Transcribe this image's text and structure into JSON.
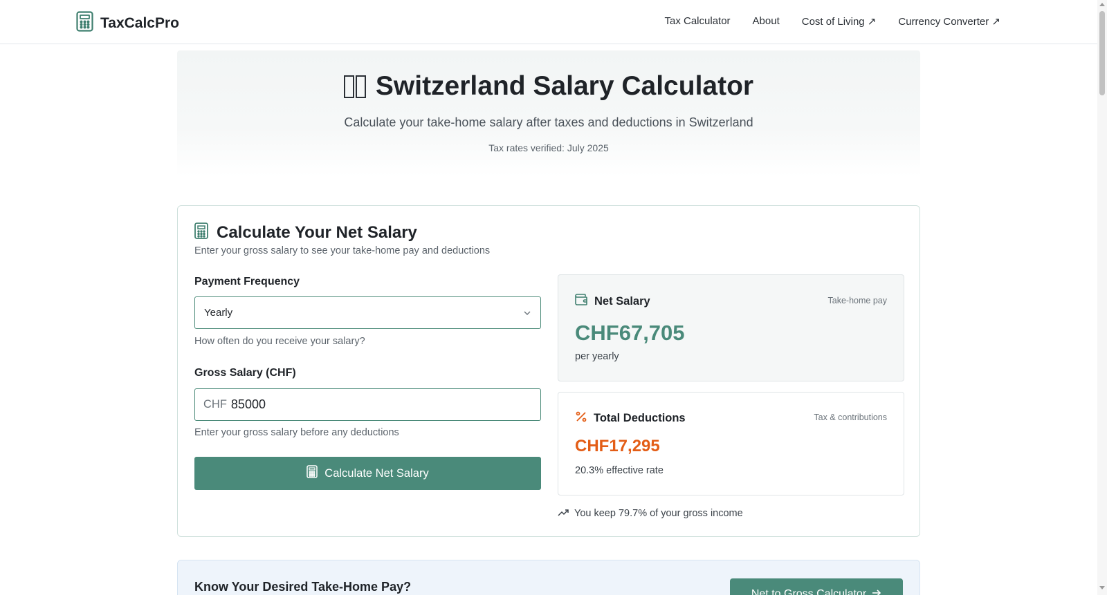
{
  "header": {
    "brand": "TaxCalcPro",
    "nav": [
      {
        "label": "Tax Calculator"
      },
      {
        "label": "About"
      },
      {
        "label": "Cost of Living ↗"
      },
      {
        "label": "Currency Converter ↗"
      }
    ]
  },
  "hero": {
    "title": "Switzerland Salary Calculator",
    "subtitle": "Calculate your take-home salary after taxes and deductions in Switzerland",
    "verified": "Tax rates verified: July 2025"
  },
  "calculator": {
    "title": "Calculate Your Net Salary",
    "description": "Enter your gross salary to see your take-home pay and deductions",
    "frequency": {
      "label": "Payment Frequency",
      "value": "Yearly",
      "help": "How often do you receive your salary?"
    },
    "gross": {
      "label": "Gross Salary (CHF)",
      "prefix": "CHF",
      "value": "85000",
      "help": "Enter your gross salary before any deductions"
    },
    "button_label": "Calculate Net Salary"
  },
  "results": {
    "net": {
      "title": "Net Salary",
      "tag": "Take-home pay",
      "value": "CHF67,705",
      "period": "per yearly"
    },
    "deductions": {
      "title": "Total Deductions",
      "tag": "Tax & contributions",
      "value": "CHF17,295",
      "rate": "20.3% effective rate"
    },
    "keep": "You keep 79.7% of your gross income"
  },
  "cta": {
    "title": "Know Your Desired Take-Home Pay?",
    "button_label": "Net to Gross Calculator"
  },
  "colors": {
    "accent": "#4a8a7a",
    "deduction": "#e35d16"
  },
  "icons": {
    "brand": "calculator-icon",
    "net": "wallet-icon",
    "deductions": "percent-icon",
    "keep": "trending-up-icon"
  }
}
